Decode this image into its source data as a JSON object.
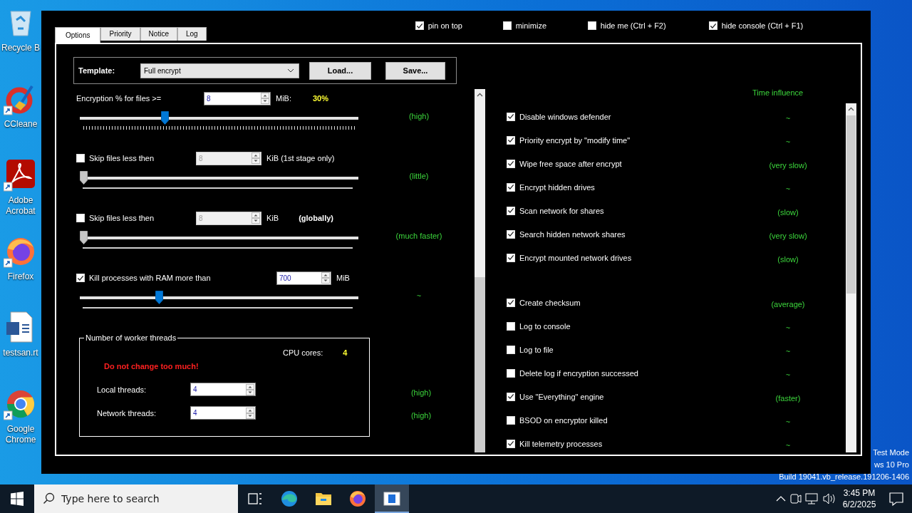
{
  "desktop_icons": [
    {
      "label": "Recycle B",
      "kind": "recycle",
      "shortcut": false
    },
    {
      "label": "CCleane",
      "kind": "cleaner",
      "shortcut": true
    },
    {
      "label": "Adobe Acrobat",
      "kind": "pdf",
      "shortcut": true
    },
    {
      "label": "Firefox",
      "kind": "firefox",
      "shortcut": true
    },
    {
      "label": "testsan.rt",
      "kind": "document",
      "shortcut": false
    },
    {
      "label": "Google Chrome",
      "kind": "chrome",
      "shortcut": true
    }
  ],
  "window": {
    "tabs": [
      {
        "label": "Options",
        "selected": true
      },
      {
        "label": "Priority",
        "selected": false
      },
      {
        "label": "Notice",
        "selected": false
      },
      {
        "label": "Log",
        "selected": false
      }
    ],
    "top_options": [
      {
        "label": "pin on top",
        "checked": true
      },
      {
        "label": "minimize",
        "checked": false
      },
      {
        "label": "hide me (Ctrl + F2)",
        "checked": false
      },
      {
        "label": "hide console (Ctrl + F1)",
        "checked": true
      }
    ],
    "template": {
      "label": "Template:",
      "value": "Full encrypt",
      "buttons": [
        "Load...",
        "Save..."
      ]
    },
    "settings": [
      {
        "kind": "plain",
        "label": "Encryption % for files >=",
        "spin": {
          "value": "8",
          "disabled": false
        },
        "unit": "MiB:",
        "reading": "30%",
        "slider": {
          "level": 0.3,
          "disabled": false,
          "ticks": true
        },
        "influence": "(high)"
      },
      {
        "kind": "check",
        "checked": false,
        "label": "Skip files less then",
        "spin": {
          "value": "8",
          "disabled": true
        },
        "unit": "KiB (1st stage only)",
        "slider": {
          "level": 0,
          "disabled": true,
          "ticks": false
        },
        "influence": "(little)"
      },
      {
        "kind": "check",
        "checked": false,
        "label": "Skip files less then",
        "spin": {
          "value": "8",
          "disabled": true
        },
        "unit": "KiB",
        "note": "(globally)",
        "slider": {
          "level": 0,
          "disabled": true,
          "ticks": false
        },
        "influence": "(much faster)"
      },
      {
        "kind": "check",
        "checked": true,
        "label": "Kill processes with RAM more than",
        "spin": {
          "value": "700",
          "disabled": false
        },
        "unit": "MiB",
        "slider": {
          "level": 0.28,
          "disabled": false,
          "ticks": false
        },
        "influence": "~"
      }
    ],
    "threads": {
      "title": "Number of worker threads",
      "cpu_label": "CPU cores:",
      "cpu_value": "4",
      "warning": "Do not change too much!",
      "fields": [
        {
          "label": "Local threads:",
          "value": "4",
          "influence": "(high)"
        },
        {
          "label": "Network threads:",
          "value": "4",
          "influence": "(high)"
        }
      ]
    },
    "influence_header": "Time influence",
    "option_groups": [
      [
        {
          "label": "Disable windows defender",
          "checked": true,
          "influence": "~"
        },
        {
          "label": "Priority encrypt by \"modify time\"",
          "checked": true,
          "influence": "~"
        },
        {
          "label": "Wipe free space after encrypt",
          "checked": true,
          "influence": "(very slow)"
        },
        {
          "label": "Encrypt hidden drives",
          "checked": true,
          "influence": "~"
        },
        {
          "label": "Scan network for shares",
          "checked": true,
          "influence": "(slow)"
        },
        {
          "label": "Search hidden network shares",
          "checked": true,
          "influence": "(very slow)"
        },
        {
          "label": "Encrypt mounted network drives",
          "checked": true,
          "influence": "(slow)"
        }
      ],
      [
        {
          "label": "Create checksum",
          "checked": true,
          "influence": "(average)"
        },
        {
          "label": "Log to console",
          "checked": false,
          "influence": "~"
        },
        {
          "label": "Log to file",
          "checked": false,
          "influence": "~"
        },
        {
          "label": "Delete log if encryption successed",
          "checked": false,
          "influence": "~"
        },
        {
          "label": "Use \"Everything\" engine",
          "checked": true,
          "influence": "(faster)"
        },
        {
          "label": "BSOD on encryptor killed",
          "checked": false,
          "influence": "~"
        },
        {
          "label": "Kill telemetry processes",
          "checked": true,
          "influence": "~"
        }
      ]
    ]
  },
  "desktop_text": [
    "Test Mode",
    "ws 10 Pro",
    "Build 19041.vb_release.191206-1406"
  ],
  "taskbar": {
    "search": {
      "placeholder": "Type here to search"
    },
    "apps": [
      {
        "kind": "taskview",
        "active": false
      },
      {
        "kind": "edge",
        "active": false
      },
      {
        "kind": "explorer",
        "active": false
      },
      {
        "kind": "firefox",
        "active": false
      },
      {
        "kind": "app",
        "active": true
      }
    ],
    "time": "3:45 PM",
    "date": "6/2/2025"
  }
}
